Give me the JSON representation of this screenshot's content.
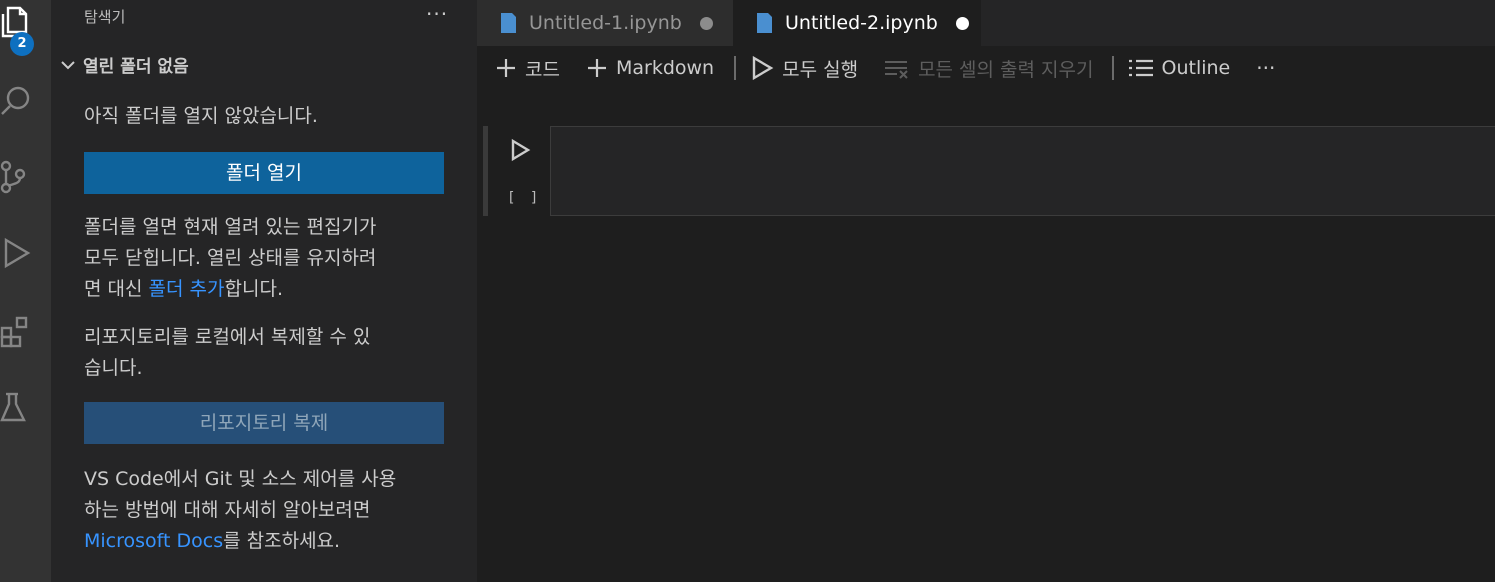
{
  "activity_bar": {
    "explorer_badge": "2",
    "icons": [
      "files-icon",
      "search-icon",
      "source-control-icon",
      "run-debug-icon",
      "extensions-icon",
      "testing-icon"
    ]
  },
  "sidebar": {
    "title": "탐색기",
    "more": "···",
    "section_header": "열린 폴더 없음",
    "no_folder_text": "아직 폴더를 열지 않았습니다.",
    "open_folder_button": "폴더 열기",
    "open_info_part1": "폴더를 열면 현재 열려 있는 편집기가",
    "open_info_part2": "모두 닫힙니다. 열린 상태를 유지하려",
    "open_info_part3": "면 대신 ",
    "add_folder_link": "폴더 추가",
    "open_info_part4": "합니다.",
    "clone_info_line1": "리포지토리를 로컬에서 복제할 수 있",
    "clone_info_line2": "습니다.",
    "clone_button": "리포지토리 복제",
    "git_info_line1": "VS Code에서 Git 및 소스 제어를 사용",
    "git_info_line2": "하는 방법에 대해 자세히 알아보려면",
    "docs_link": "Microsoft Docs",
    "git_info_suffix": "를 참조하세요."
  },
  "tabs": [
    {
      "label": "Untitled-1.ipynb",
      "active": false
    },
    {
      "label": "Untitled-2.ipynb",
      "active": true
    }
  ],
  "toolbar": {
    "add_code": "코드",
    "add_markdown": "Markdown",
    "run_all": "모두 실행",
    "clear_outputs": "모든 셀의 출력 지우기",
    "outline": "Outline",
    "more": "···"
  },
  "cell": {
    "execution_count": "[ ]"
  },
  "colors": {
    "accent": "#0e639c",
    "link": "#3794ff",
    "badge": "#0e70c0"
  }
}
